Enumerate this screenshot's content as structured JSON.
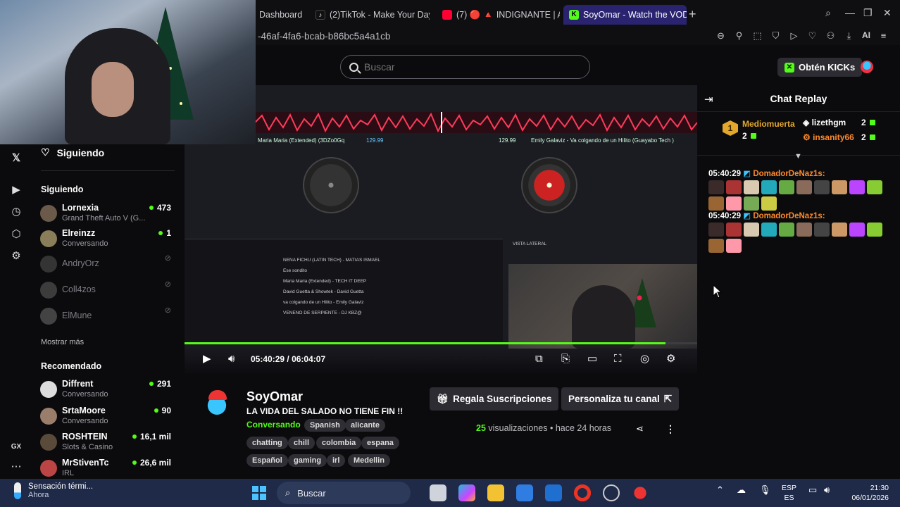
{
  "browser": {
    "tabs": [
      {
        "label": "Dashboard",
        "icon": "page-icon",
        "color": "#0f0f12"
      },
      {
        "label": "(2)TikTok - Make Your Day",
        "icon": "tiktok-icon",
        "color": "#0f0f12"
      },
      {
        "label": "(7) 🔴 🔺 INDIGNANTE | A",
        "icon": "youtube-icon",
        "color": "#0f0f12"
      },
      {
        "label": "SoyOmar - Watch the VOD",
        "icon": "kick-icon",
        "color": "#2a2470",
        "active": true
      }
    ],
    "url": "-46af-4fa6-bcab-b86bc5a4a1cb",
    "ai_label": "AI"
  },
  "header": {
    "search_placeholder": "Buscar",
    "kicks_button": "Obtén KICKs"
  },
  "sidebar": {
    "following_title": "Siguiendo",
    "section_following": "Siguiendo",
    "following": [
      {
        "name": "Lornexia",
        "sub": "Grand Theft Auto V (G...",
        "count": "473",
        "live": true,
        "color": "#6b5a4a"
      },
      {
        "name": "Elreinzz",
        "sub": "Conversando",
        "count": "1",
        "live": true,
        "color": "#8a7d5a"
      },
      {
        "name": "AndryOrz",
        "sub": "",
        "count": "",
        "live": false,
        "color": "#666"
      },
      {
        "name": "Coll4zos",
        "sub": "",
        "count": "",
        "live": false,
        "color": "#777"
      },
      {
        "name": "ElMune",
        "sub": "",
        "count": "",
        "live": false,
        "color": "#888"
      }
    ],
    "show_more": "Mostrar más",
    "section_recommended": "Recomendado",
    "recommended": [
      {
        "name": "Diffrent",
        "sub": "Conversando",
        "count": "291",
        "color": "#ddd"
      },
      {
        "name": "SrtaMoore",
        "sub": "Conversando",
        "count": "90",
        "color": "#9a7d6b"
      },
      {
        "name": "ROSHTEIN",
        "sub": "Slots & Casino",
        "count": "16,1 mil",
        "color": "#5a4a3a"
      },
      {
        "name": "MrStivenTc",
        "sub": "IRL",
        "count": "26,6 mil",
        "color": "#b44"
      }
    ],
    "rail_icons": [
      "x-logo-icon",
      "browse-icon",
      "history-icon",
      "extensions-icon",
      "settings-icon",
      "gx-icon",
      "more-icon"
    ]
  },
  "player": {
    "current_time": "05:40:29",
    "separator": "/",
    "duration": "06:04:07",
    "progress_fraction": 0.938,
    "dj_overlay": {
      "left_track": "Maria Maria (Extended) (3DZo0Gq",
      "right_track": "Emily Galaviz - Va colgando de un Hilito (Guayabo Tech )",
      "bpm_left": "129.99",
      "bpm_right": "129.99",
      "library": [
        "NENA FICHU (LATIN TECH) - MATIAS ISMAEL",
        "Ese sondito",
        "Maria Maria (Extended) - TECH IT DEEP",
        "David Guetta & Showtek - David Guetta",
        "va colgando de un Hilito - Emily Galaviz",
        "VENENO DE SERPIENTE - DJ KBZ@"
      ],
      "panel_label": "VISTA LATERAL"
    }
  },
  "stream": {
    "streamer": "SoyOmar",
    "title": "LA VIDA DEL SALADO NO TIENE FIN !!",
    "category": "Conversando",
    "tags_row1": [
      "Spanish",
      "alicante"
    ],
    "tags_row2": [
      "chatting",
      "chill",
      "colombia",
      "espana"
    ],
    "tags_row3": [
      "Español",
      "gaming",
      "irl",
      "Medellin"
    ],
    "gift_button": "Regala Suscripciones",
    "customize_button": "Personaliza tu canal",
    "views_count": "25",
    "views_label": "visualizaciones",
    "bullet": "•",
    "time_ago": "hace 24 horas"
  },
  "chat": {
    "title": "Chat Replay",
    "top_gifters": [
      {
        "rank": "1",
        "name": "Mediomuerta",
        "count": "2",
        "color": "#e3a72c"
      },
      {
        "name": "lizethgm",
        "count": "2",
        "color": "#ffffff"
      },
      {
        "name": "insanity66",
        "count": "2",
        "color": "#ff8a2b"
      }
    ],
    "messages": [
      {
        "time": "05:40:29",
        "user": "DomadorDeNaz1s:",
        "emotes": 14
      },
      {
        "time": "05:40:29",
        "user": "DomadorDeNaz1s:",
        "emotes": 12
      }
    ]
  },
  "taskbar": {
    "weather_title": "Sensación térmi...",
    "weather_sub": "Ahora",
    "search_label": "Buscar",
    "lang_top": "ESP",
    "lang_bottom": "ES",
    "time": "21:30",
    "date": "06/01/2026"
  },
  "colors": {
    "kick_green": "#53fc18",
    "chat_username": "#ff8a2b",
    "taskbar": "#1e2a48"
  }
}
